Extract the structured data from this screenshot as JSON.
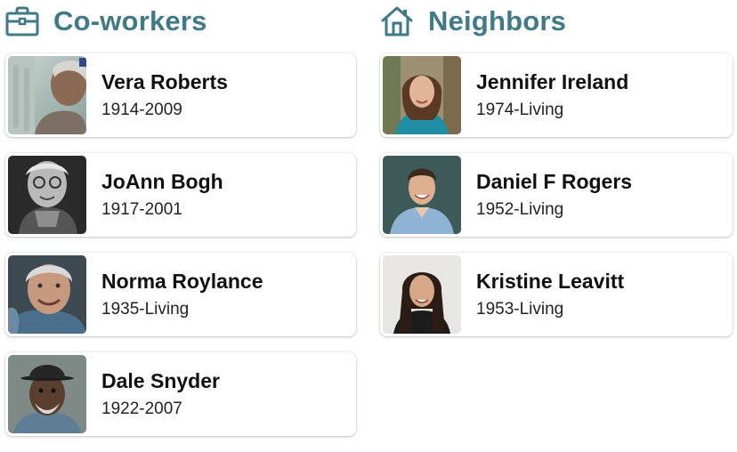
{
  "coworkers": {
    "title": "Co-workers",
    "icon": "briefcase-icon",
    "people": [
      {
        "name": "Vera Roberts",
        "years": "1914-2009"
      },
      {
        "name": "JoAnn Bogh",
        "years": "1917-2001"
      },
      {
        "name": "Norma Roylance",
        "years": "1935-Living"
      },
      {
        "name": "Dale Snyder",
        "years": "1922-2007"
      }
    ]
  },
  "neighbors": {
    "title": "Neighbors",
    "icon": "house-icon",
    "people": [
      {
        "name": "Jennifer Ireland",
        "years": "1974-Living"
      },
      {
        "name": "Daniel F Rogers",
        "years": "1952-Living"
      },
      {
        "name": "Kristine Leavitt",
        "years": "1953-Living"
      }
    ]
  },
  "colors": {
    "accent": "#3f7a86",
    "name_text": "#111111",
    "card_bg": "#ffffff"
  }
}
